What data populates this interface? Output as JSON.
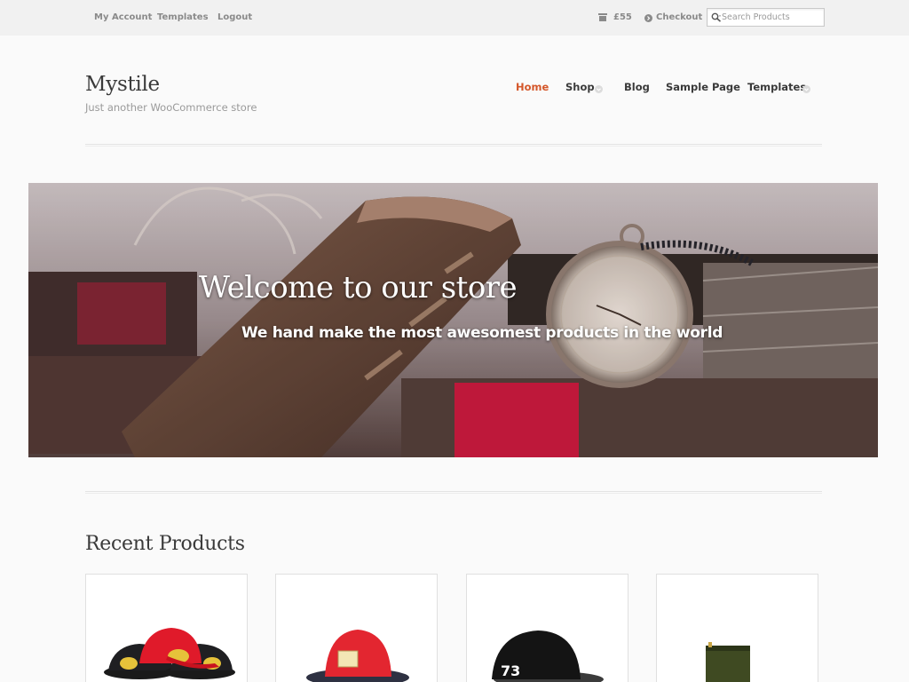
{
  "topbar": {
    "links": [
      "My Account",
      "Templates",
      "Logout"
    ],
    "cart_total": "£55",
    "checkout_label": "Checkout",
    "search_placeholder": "Search Products"
  },
  "site": {
    "title": "Mystile",
    "tagline": "Just another WooCommerce store"
  },
  "nav": {
    "items": [
      {
        "label": "Home",
        "active": true,
        "has_dropdown": false
      },
      {
        "label": "Shop",
        "active": false,
        "has_dropdown": true
      },
      {
        "label": "Blog",
        "active": false,
        "has_dropdown": false
      },
      {
        "label": "Sample Page",
        "active": false,
        "has_dropdown": false
      },
      {
        "label": "Templates",
        "active": false,
        "has_dropdown": true
      }
    ]
  },
  "hero": {
    "title": "Welcome to our store",
    "subtitle": "We hand make the most awesomest products in the world"
  },
  "recent_products": {
    "title": "Recent Products",
    "items": [
      {
        "icon": "red-black-caps-image"
      },
      {
        "icon": "red-cap-image"
      },
      {
        "icon": "black-cap-73-image"
      },
      {
        "icon": "green-pouch-image"
      }
    ]
  },
  "colors": {
    "accent": "#d4572a",
    "text": "#3a3a3a",
    "muted": "#8a8a8a",
    "topbar_bg": "#f1f1f1",
    "page_bg": "#fafafa"
  }
}
